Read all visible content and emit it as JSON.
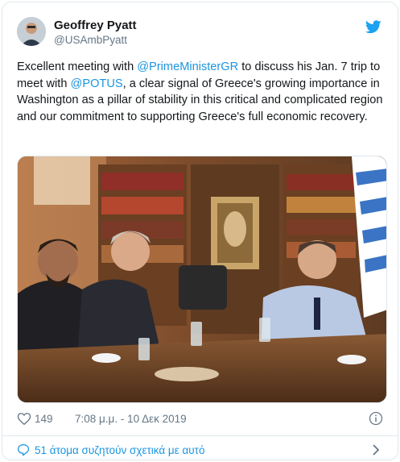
{
  "user": {
    "display_name": "Geoffrey Pyatt",
    "handle": "@USAmbPyatt"
  },
  "tweet": {
    "text_1": "Excellent meeting with ",
    "mention_1": "@PrimeMinisterGR",
    "text_2": " to discuss his Jan. 7 trip to meet with ",
    "mention_2": "@POTUS",
    "text_3": ", a clear signal of Greece's growing importance in Washington as a pillar of stability in this critical and complicated region and our commitment to supporting Greece's full economic recovery."
  },
  "stats": {
    "likes": "149",
    "timestamp": "7:08 μ.μ. - 10 Δεκ 2019"
  },
  "footer": {
    "label": "51 άτομα συζητούν σχετικά με αυτό"
  },
  "icons": {
    "brand": "twitter-bird-icon",
    "like": "heart-icon",
    "info": "info-icon",
    "reply": "speech-bubble-icon",
    "chevron": "chevron-right-icon"
  },
  "colors": {
    "brand": "#1da1f2",
    "link": "#1b95e0",
    "secondary_text": "#657786"
  }
}
